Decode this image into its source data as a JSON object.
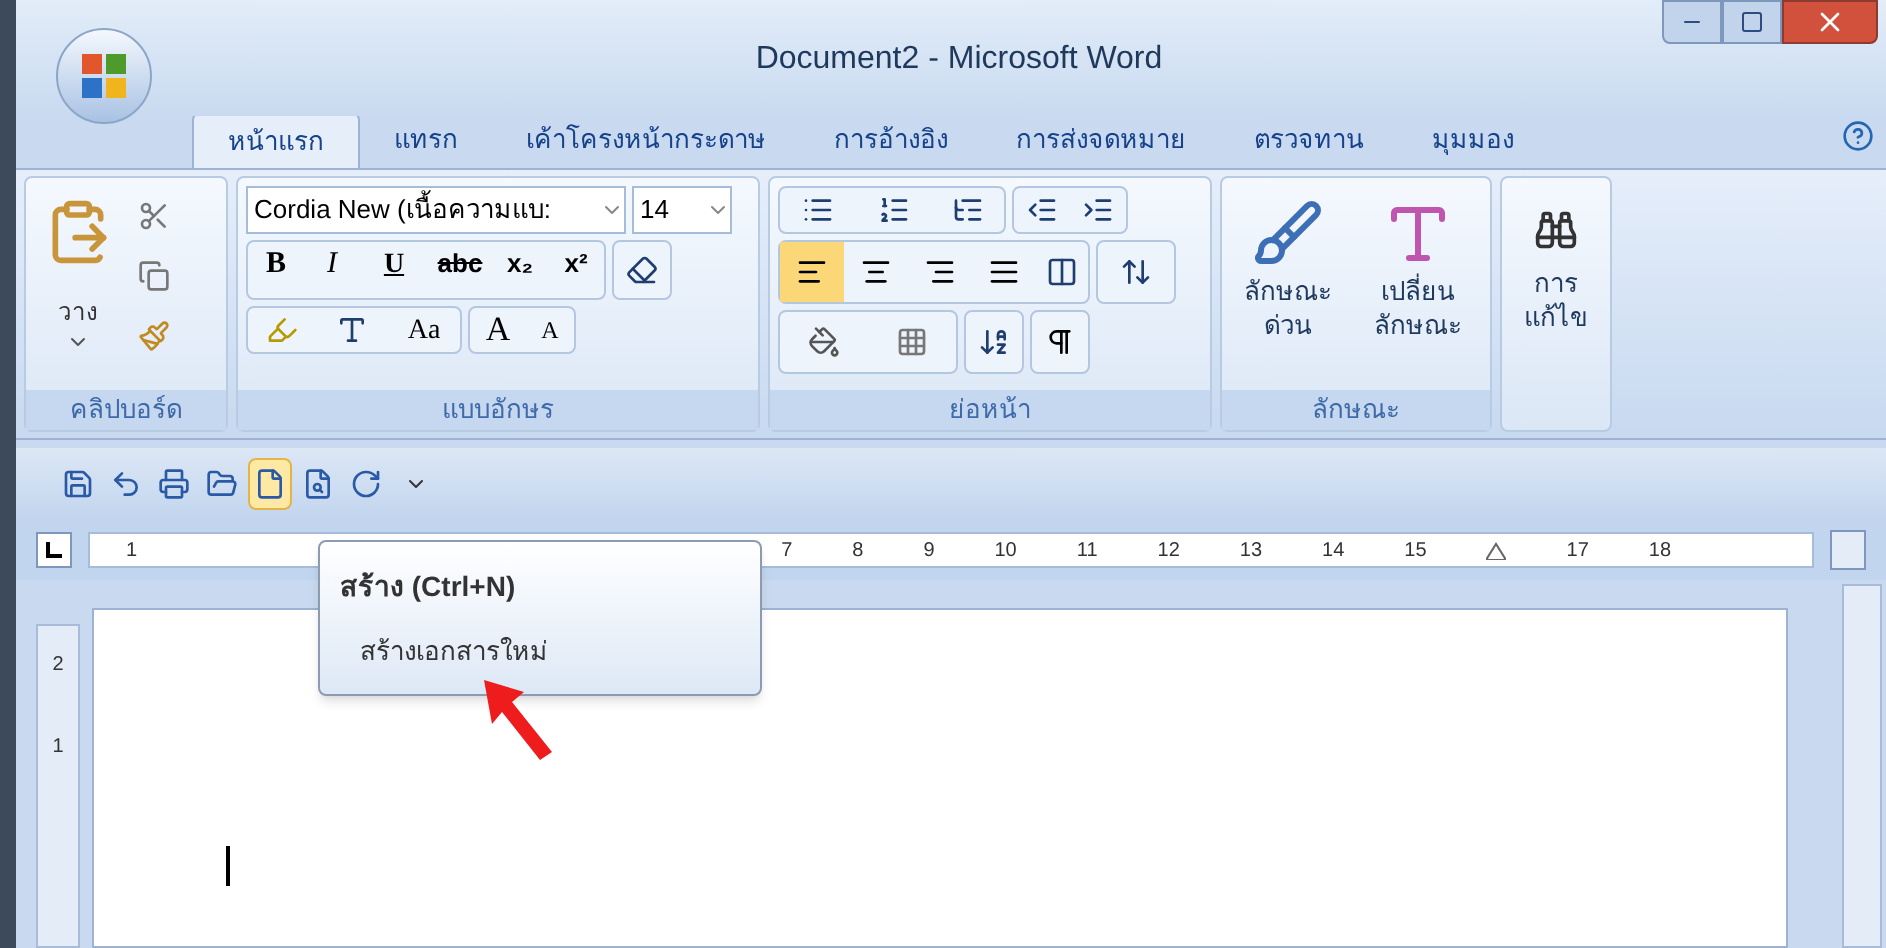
{
  "window": {
    "title": "Document2 - Microsoft Word"
  },
  "tabs": [
    {
      "label": "หน้าแรก",
      "selected": true
    },
    {
      "label": "แทรก",
      "selected": false
    },
    {
      "label": "เค้าโครงหน้ากระดาษ",
      "selected": false
    },
    {
      "label": "การอ้างอิง",
      "selected": false
    },
    {
      "label": "การส่งจดหมาย",
      "selected": false
    },
    {
      "label": "ตรวจทาน",
      "selected": false
    },
    {
      "label": "มุมมอง",
      "selected": false
    }
  ],
  "clipboard": {
    "paste_label": "วาง",
    "group_label": "คลิปบอร์ด"
  },
  "font": {
    "font_name": "Cordia New (เนื้อความแบ:",
    "font_size": "14",
    "bold": "B",
    "italic": "I",
    "underline": "U",
    "strike": "abc",
    "subscript": "x₂",
    "superscript": "x²",
    "case": "Aa",
    "grow": "A",
    "shrink": "A",
    "group_label": "แบบอักษร"
  },
  "paragraph": {
    "alignments": [
      {
        "selected": true
      },
      {
        "selected": false
      },
      {
        "selected": false
      },
      {
        "selected": false
      }
    ],
    "group_label": "ย่อหน้า"
  },
  "styles": {
    "quick_styles": [
      "ลักษณะ",
      "ด่วน"
    ],
    "change_styles": [
      "เปลี่ยน",
      "ลักษณะ"
    ],
    "group_label": "ลักษณะ"
  },
  "editing": {
    "label": [
      "การ",
      "แก้ไข"
    ]
  },
  "quick_access": [
    {
      "kind": "save",
      "selected": false
    },
    {
      "kind": "undo",
      "selected": false
    },
    {
      "kind": "print",
      "selected": false
    },
    {
      "kind": "open",
      "selected": false
    },
    {
      "kind": "new",
      "selected": true
    },
    {
      "kind": "preview",
      "selected": false
    },
    {
      "kind": "redo",
      "selected": false
    }
  ],
  "ruler": {
    "left_numbers": [
      "1"
    ],
    "right_numbers": [
      "7",
      "8",
      "9",
      "10",
      "11",
      "12",
      "13",
      "14",
      "15"
    ],
    "end_numbers": [
      "17",
      "18"
    ],
    "vertical_numbers": [
      "2",
      "1"
    ]
  },
  "tooltip": {
    "title": "สร้าง (Ctrl+N)",
    "description": "สร้างเอกสารใหม่"
  }
}
